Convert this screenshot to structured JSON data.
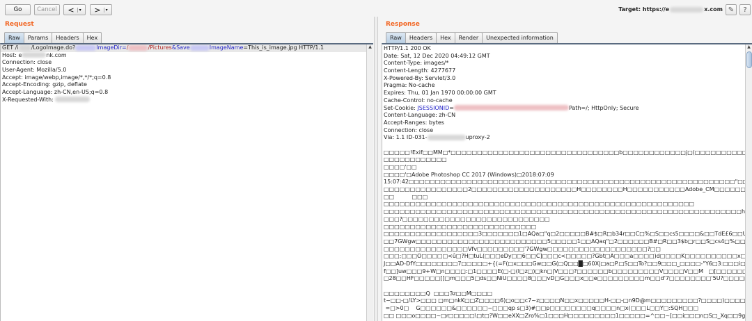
{
  "toolbar": {
    "go": "Go",
    "cancel": "Cancel",
    "back": "<",
    "back_menu": "▾",
    "forward": ">",
    "forward_menu": "▾",
    "target_label": "Target: https://e",
    "target_suffix": "x.com",
    "edit_icon": "pencil-icon",
    "help": "?"
  },
  "request": {
    "title": "Request",
    "tabs": [
      "Raw",
      "Params",
      "Headers",
      "Hex"
    ],
    "lines": [
      [
        {
          "t": "GET /i"
        },
        {
          "b": "gray",
          "w": 18
        },
        {
          "t": "/LogoImage.do?"
        },
        {
          "b": "blue",
          "w": 30
        },
        {
          "t": "ImageDir=",
          "c": "blue"
        },
        {
          "t": "/",
          "c": "red"
        },
        {
          "b": "red",
          "w": 28
        },
        {
          "t": "/Pictures",
          "c": "red"
        },
        {
          "t": "&Save",
          "c": "blue"
        },
        {
          "b": "blue",
          "w": 28
        },
        {
          "t": "ImageName",
          "c": "blue"
        },
        {
          "t": "=This_is_image.jpg HTTP/1.1"
        }
      ],
      [
        {
          "t": "Host: e"
        },
        {
          "b": "gray",
          "w": 35
        },
        {
          "t": "nk.com"
        }
      ],
      [
        {
          "t": "Connection: close"
        }
      ],
      [
        {
          "t": "User-Agent: Mozilla/5.0"
        }
      ],
      [
        {
          "t": "Accept: image/webp,image/*,*/*;q=0.8"
        }
      ],
      [
        {
          "t": "Accept-Encoding: gzip, deflate"
        }
      ],
      [
        {
          "t": "Accept-Language: zh-CN,en-US;q=0.8"
        }
      ],
      [
        {
          "t": "X-Requested-With: "
        },
        {
          "b": "gray",
          "w": 50
        }
      ]
    ]
  },
  "response": {
    "title": "Response",
    "tabs": [
      "Raw",
      "Headers",
      "Hex",
      "Render",
      "Unexpected information"
    ],
    "lines": [
      [
        {
          "t": "HTTP/1.1 200 OK"
        }
      ],
      [
        {
          "t": "Date: Sat, 12 Dec 2020 04:49:12 GMT"
        }
      ],
      [
        {
          "t": "Content-Type: images/*"
        }
      ],
      [
        {
          "t": "Content-Length: 4277677"
        }
      ],
      [
        {
          "t": "X-Powered-By: Servlet/3.0"
        }
      ],
      [
        {
          "t": "Pragma: No-cache"
        }
      ],
      [
        {
          "t": "Expires: Thu, 01 Jan 1970 00:00:00 GMT"
        }
      ],
      [
        {
          "t": "Cache-Control: no-cache"
        }
      ],
      [
        {
          "t": "Set-Cookie: "
        },
        {
          "t": "JSESSIONID",
          "c": "blue"
        },
        {
          "t": "="
        },
        {
          "b": "red",
          "w": 165
        },
        {
          "t": "Path=/; HttpOnly; Secure"
        }
      ],
      [
        {
          "t": "Content-Language: zh-CN"
        }
      ],
      [
        {
          "t": "Accept-Ranges: bytes"
        }
      ],
      [
        {
          "t": "Connection: close"
        }
      ],
      [
        {
          "t": "Via: 1.1 ID-031-"
        },
        {
          "b": "gray",
          "w": 55
        },
        {
          "t": "uproxy-2"
        }
      ],
      [
        {
          "t": ""
        }
      ],
      [
        {
          "t": "□□□□□!Exif□□MM□*□□□□□□□□□□□□□□□□□□□□□□□□□□□□□□□□b□□□□□□□□□□□□j□(□□□□□□□□□□□1□□□□□\"□□□r□2□□□□□□□□□□□□□□□i□□"
        }
      ],
      [
        {
          "t": "□□□□□□□□□□□□"
        }
      ],
      [
        {
          "t": "□□□□'□□"
        }
      ],
      [
        {
          "t": "□□□□'□Adobe Photoshop CC 2017 (Windows)□2018:07:09"
        }
      ],
      [
        {
          "t": "15:07:42□□□□□□□□□□□□□□□□□□□□□□□□□□□□□□□□□□□□□□□□□□□□□□□□□□□□□□□□□□□□□□\"□□□□□□□□□□□*□(□□□□□"
        }
      ],
      [
        {
          "t": "□□□□□□□□□□□□□□□□2□□□□□□□□□□□□□□□□□□□□H□□□□□□□□H□□□□□□□□□□□Adobe_CM□□□□□□□Adobe□d□□□□□□□□□□□□□□□"
        }
      ],
      [
        {
          "t": "□□          □□□"
        }
      ],
      [
        {
          "t": "□□□□□□□□□□□□□□□□□□□□□□□□□□□□□□□□□□□□□□□□□□□□□□□□□□□□□□□□□□□"
        }
      ],
      [
        {
          "t": "□□□□□□□□□□□□□□□□□□□□□□□□□□□□□□□□□□□□□□□□□□□□□□□□□□□□□□□□□□□□□□□□□□□□h□□□□\"□□□□□□□□□□□□"
        }
      ],
      [
        {
          "t": "□□□?□□□□□□□□□□□□□□□□□□□□□□□□□□□□"
        }
      ],
      [
        {
          "t": "□□□□□□□□□□□□□□□□□□□□□□□□□□□□□"
        }
      ],
      [
        {
          "t": "□□□□□□□□□□□□□□□□□□3□□□□□□□1□AQa□\"q□2□□□□□B#$□R□b34r□□C□%□S□□cs5□□□□&□□TdE£6□□U□e□□u□F'□□□□□□□□□□"
        }
      ],
      [
        {
          "t": "□□7GWgw□□□□□□□□□□□□□□□□□□□□□□□□□5□□□□□1□□AQaq\"□2□□□□□□B#□R□□3$b□r□□S□cs4□%□□□□□□&5□□□□T□□dEU6te"
        }
      ],
      [
        {
          "t": "□□□□□□□□□□□□□□□□Vfv□□□□□□□□□'7GWgw□□□□□□□□□□□□□□□□□□□?□□"
        }
      ],
      [
        {
          "t": "□□□;□□□O□□□□□<û□?H□tuL(□□□eDy□□6□□C]□□□c<□□□□□?Gbt□A□□□a□□□□)d□□□□K□□□□□□□□□□x□□□□□□□□O□□□□□~□□□YN(□□.2/□"
        }
      ],
      [
        {
          "t": "J□□AD-DfY□□□□□□□□7□□□□□+{(=F(□x□□□Gw□□G(□Q□□█□60X|□a□P.□S□□To?□□9□□□_□□□□-\"Y6□3:□□□i□="
        }
      ],
      [
        {
          "t": "f□□]uw□□□9+W□n□□□□:□1□□□□E(□-□(l□z□)□kn□|V□□□?□□□□□□b□□□□□□□□□V□□□□V□□M   □[□□□□□□*f□$□□□Rk□□W□□"
        }
      ],
      [
        {
          "t": "□28□□HF□□□□□[]□m□□□5□ds□□NiU□□□□8□□□vD□G□□□x□□e□□□□□□□□□m□□d'7□□□□□□□□'5U?□□□□□1~□□□□□□□□□,y<□□□□□□□p□V□□□□"
        }
      ],
      [
        {
          "t": ""
        }
      ],
      [
        {
          "t": "□□□□□□□□Q  □□□3z□□M□□□□"
        }
      ],
      [
        {
          "t": "t~□□-□/LY>□□□ □m□nkK□□Z□□□□6)□o□□c7~z□□□□N□□x□□□□□H-□□-□n9D@m□□□□□□□□□?□□□□)□□□□□N*□□□□□□'□□□□= □□"
        }
      ],
      [
        {
          "t": " =□>0□    G□□□□□□&□□□□□□~□□□qp s□3)#□□p□□□□□□□□q□□□□n□x(□□□L□□Y□:SQH□□□"
        }
      ],
      [
        {
          "t": "□□ □□□o□□□□~□r□□□□□\\□t□?W□□eXX□Zro%□1□□□H□□□□□□□□□1□□□□□=^□□~[□□i□□□n□S□_Xq□□9g"
        }
      ]
    ]
  },
  "colors": {
    "accent": "#f26522",
    "key_blue": "#2424c8",
    "value_red": "#b02020"
  }
}
